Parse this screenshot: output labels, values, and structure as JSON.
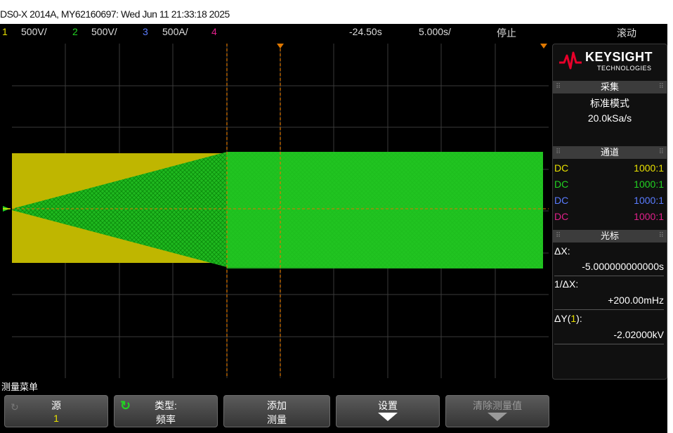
{
  "title": "DS0-X 2014A, MY62160697: Wed Jun 11 21:33:18 2025",
  "status": {
    "ch1_num": "1",
    "ch1_scale": "500V/",
    "ch2_num": "2",
    "ch2_scale": "500V/",
    "ch3_num": "3",
    "ch3_scale": "500A/",
    "ch4_num": "4",
    "time_delay": "-24.50s",
    "time_scale": "5.000s/",
    "run_state": "停止",
    "mode": "滚动"
  },
  "brand": {
    "name": "KEYSIGHT",
    "sub": "TECHNOLOGIES"
  },
  "acquire": {
    "title": "采集",
    "mode": "标准模式",
    "rate": "20.0kSa/s"
  },
  "channels_panel": {
    "title": "通道",
    "rows": [
      {
        "coupling": "DC",
        "probe": "1000:1",
        "color": "#e8e000"
      },
      {
        "coupling": "DC",
        "probe": "1000:1",
        "color": "#22d322"
      },
      {
        "coupling": "DC",
        "probe": "1000:1",
        "color": "#5a7cff"
      },
      {
        "coupling": "DC",
        "probe": "1000:1",
        "color": "#e0208a"
      }
    ]
  },
  "cursors": {
    "title": "光标",
    "dx_label": "ΔX:",
    "dx_value": "-5.000000000000s",
    "inv_dx_label": "1/ΔX:",
    "inv_dx_value": "+200.00mHz",
    "dy_label_prefix": "ΔY(",
    "dy_label_ch": "1",
    "dy_label_suffix": "):",
    "dy_value": "-2.02000kV"
  },
  "menu": {
    "label": "测量菜单",
    "softkeys": [
      {
        "line1": "源",
        "line2": "1"
      },
      {
        "line1": "类型:",
        "line2": "频率"
      },
      {
        "line1": "添加",
        "line2": "测量"
      },
      {
        "line1": "设置"
      },
      {
        "line1": "清除测量值"
      }
    ]
  },
  "colors": {
    "ch1": "#e8e000",
    "ch2": "#22d322",
    "ch3": "#5a7cff",
    "ch4": "#e0208a",
    "cursor": "#e07800",
    "keysight_red": "#e8002a"
  }
}
